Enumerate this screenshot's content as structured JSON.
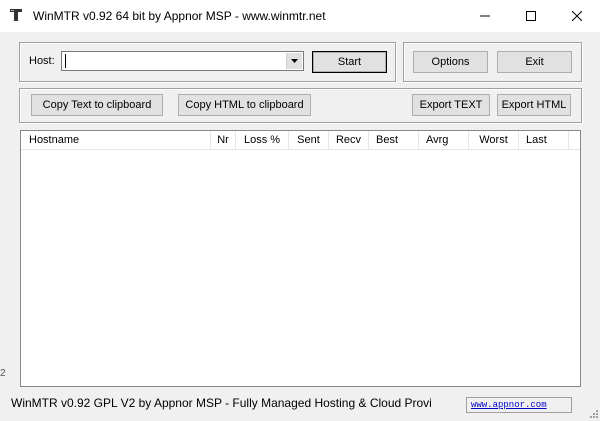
{
  "window": {
    "title": "WinMTR v0.92 64 bit by Appnor MSP - www.winmtr.net"
  },
  "host": {
    "label": "Host:",
    "value": ""
  },
  "buttons": {
    "start": "Start",
    "options": "Options",
    "exit": "Exit",
    "copy_text": "Copy Text to clipboard",
    "copy_html": "Copy HTML to clipboard",
    "export_text": "Export TEXT",
    "export_html": "Export HTML"
  },
  "table": {
    "columns": [
      "Hostname",
      "Nr",
      "Loss %",
      "Sent",
      "Recv",
      "Best",
      "Avrg",
      "Worst",
      "Last"
    ],
    "rows": []
  },
  "status": {
    "text": "WinMTR v0.92 GPL V2 by Appnor MSP - Fully Managed Hosting & Cloud Provi",
    "link": "www.appnor.com"
  },
  "edge_glyph": "2",
  "icons": {
    "app": "winmtr-app-icon",
    "minimize": "minimize-icon",
    "maximize": "maximize-icon",
    "close": "close-icon",
    "dropdown": "chevron-down-icon",
    "grip": "resize-grip-icon"
  }
}
